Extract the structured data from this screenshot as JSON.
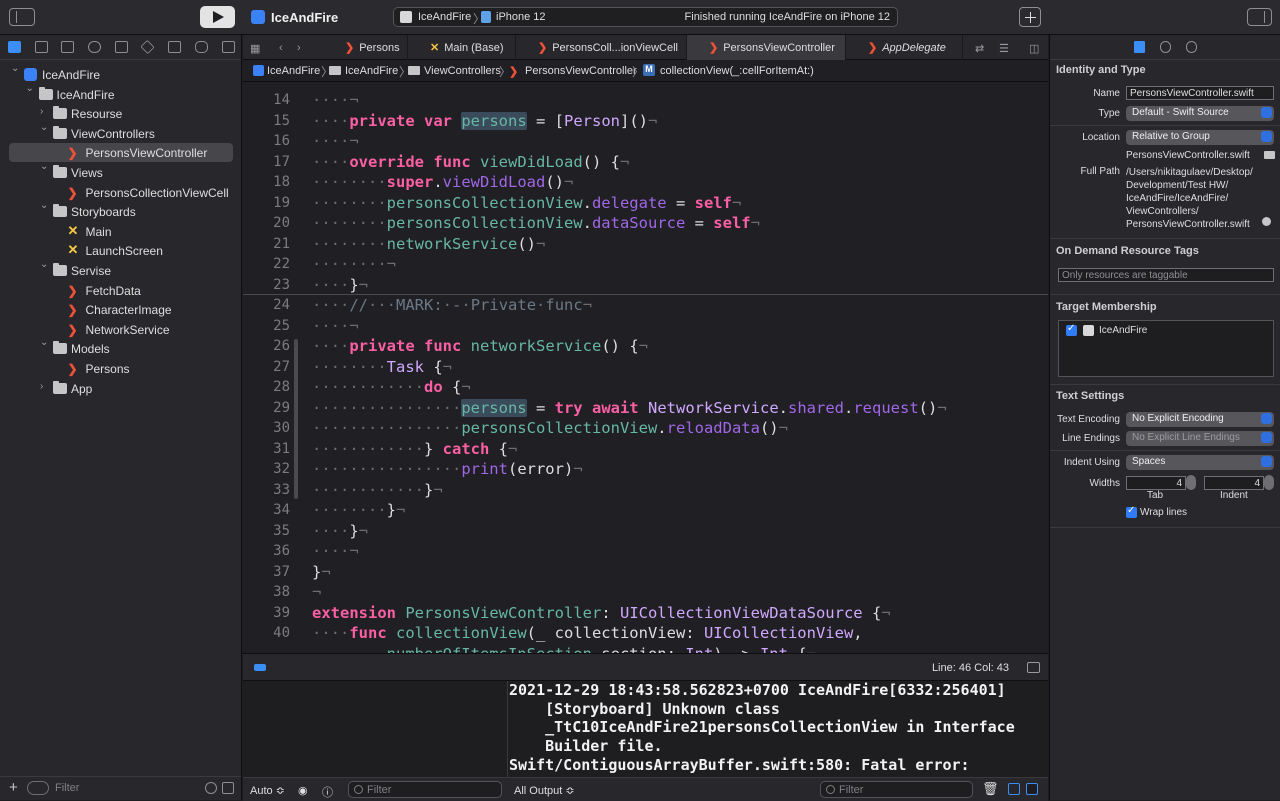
{
  "toolbar": {
    "scheme_title": "IceAndFire",
    "activity_scheme": "IceAndFire",
    "activity_destination": "iPhone 12",
    "activity_status": "Finished running IceAndFire on iPhone 12",
    "separator": "〉"
  },
  "navigator": {
    "items": [
      {
        "label": "IceAndFire",
        "depth": 0,
        "kind": "project",
        "disclosure": "open"
      },
      {
        "label": "IceAndFire",
        "depth": 1,
        "kind": "folder",
        "disclosure": "open"
      },
      {
        "label": "Resourse",
        "depth": 2,
        "kind": "folder",
        "disclosure": "closed"
      },
      {
        "label": "ViewControllers",
        "depth": 2,
        "kind": "folder",
        "disclosure": "open"
      },
      {
        "label": "PersonsViewController",
        "depth": 3,
        "kind": "swift",
        "selected": true
      },
      {
        "label": "Views",
        "depth": 2,
        "kind": "folder",
        "disclosure": "open"
      },
      {
        "label": "PersonsCollectionViewCell",
        "depth": 3,
        "kind": "swift"
      },
      {
        "label": "Storyboards",
        "depth": 2,
        "kind": "folder",
        "disclosure": "open"
      },
      {
        "label": "Main",
        "depth": 3,
        "kind": "storyboard"
      },
      {
        "label": "LaunchScreen",
        "depth": 3,
        "kind": "storyboard"
      },
      {
        "label": "Servise",
        "depth": 2,
        "kind": "folder",
        "disclosure": "open"
      },
      {
        "label": "FetchData",
        "depth": 3,
        "kind": "swift"
      },
      {
        "label": "CharacterImage",
        "depth": 3,
        "kind": "swift"
      },
      {
        "label": "NetworkService",
        "depth": 3,
        "kind": "swift"
      },
      {
        "label": "Models",
        "depth": 2,
        "kind": "folder",
        "disclosure": "open"
      },
      {
        "label": "Persons",
        "depth": 3,
        "kind": "swift"
      },
      {
        "label": "App",
        "depth": 2,
        "kind": "folder",
        "disclosure": "closed"
      }
    ],
    "filter_placeholder": "Filter",
    "add_label": "+"
  },
  "editor": {
    "tabs": [
      {
        "label": "Persons",
        "icon": "swift"
      },
      {
        "label": "Main (Base)",
        "icon": "storyboard"
      },
      {
        "label": "PersonsColl...ionViewCell",
        "icon": "swift"
      },
      {
        "label": "PersonsViewController",
        "icon": "swift",
        "active": true
      },
      {
        "label": "AppDelegate",
        "icon": "swift",
        "italic": true
      }
    ],
    "jump_bar": [
      "IceAndFire",
      "IceAndFire",
      "ViewControllers",
      "PersonsViewController",
      "collectionView(_:cellForItemAt:)"
    ],
    "jump_method_badge": "M",
    "code_lines": [
      {
        "n": "14",
        "segs": [
          [
            "inv",
            "····¬"
          ]
        ]
      },
      {
        "n": "15",
        "segs": [
          [
            "inv",
            "····"
          ],
          [
            "kw",
            "private"
          ],
          [
            "",
            " "
          ],
          [
            "kw",
            "var"
          ],
          [
            "",
            " "
          ],
          [
            "idhl",
            "persons"
          ],
          [
            "",
            " = ["
          ],
          [
            "ty",
            "Person"
          ],
          [
            "",
            "]()"
          ],
          [
            "inv",
            "¬"
          ]
        ]
      },
      {
        "n": "16",
        "segs": [
          [
            "inv",
            "····¬"
          ]
        ]
      },
      {
        "n": "17",
        "segs": [
          [
            "inv",
            "····"
          ],
          [
            "kw",
            "override"
          ],
          [
            "",
            " "
          ],
          [
            "kw",
            "func"
          ],
          [
            "",
            " "
          ],
          [
            "id",
            "viewDidLoad"
          ],
          [
            "",
            "() {"
          ],
          [
            "inv",
            "¬"
          ]
        ]
      },
      {
        "n": "18",
        "segs": [
          [
            "inv",
            "········"
          ],
          [
            "kw",
            "super"
          ],
          [
            "",
            "."
          ],
          [
            "fn",
            "viewDidLoad"
          ],
          [
            "",
            "()"
          ],
          [
            "inv",
            "¬"
          ]
        ]
      },
      {
        "n": "19",
        "segs": [
          [
            "inv",
            "········"
          ],
          [
            "id",
            "personsCollectionView"
          ],
          [
            "",
            "."
          ],
          [
            "fn",
            "delegate"
          ],
          [
            "",
            " = "
          ],
          [
            "kw",
            "self"
          ],
          [
            "inv",
            "¬"
          ]
        ]
      },
      {
        "n": "20",
        "segs": [
          [
            "inv",
            "········"
          ],
          [
            "id",
            "personsCollectionView"
          ],
          [
            "",
            "."
          ],
          [
            "fn",
            "dataSource"
          ],
          [
            "",
            " = "
          ],
          [
            "kw",
            "self"
          ],
          [
            "inv",
            "¬"
          ]
        ]
      },
      {
        "n": "21",
        "segs": [
          [
            "inv",
            "········"
          ],
          [
            "id",
            "networkService"
          ],
          [
            "",
            "()"
          ],
          [
            "inv",
            "¬"
          ]
        ]
      },
      {
        "n": "22",
        "segs": [
          [
            "inv",
            "········¬"
          ]
        ]
      },
      {
        "n": "23",
        "segs": [
          [
            "inv",
            "····"
          ],
          [
            "",
            "}"
          ],
          [
            "inv",
            "¬"
          ]
        ]
      },
      {
        "n": "24",
        "segs": [
          [
            "inv",
            "····"
          ],
          [
            "cm",
            "//"
          ],
          [
            "inv",
            "···"
          ],
          [
            "cm",
            "MARK:"
          ],
          [
            "inv",
            "·"
          ],
          [
            "cm",
            "-"
          ],
          [
            "inv",
            "·"
          ],
          [
            "cm",
            "Private"
          ],
          [
            "inv",
            "·"
          ],
          [
            "cm",
            "func"
          ],
          [
            "inv",
            "¬"
          ]
        ]
      },
      {
        "n": "25",
        "segs": [
          [
            "inv",
            "····¬"
          ]
        ]
      },
      {
        "n": "26",
        "segs": [
          [
            "inv",
            "····"
          ],
          [
            "kw",
            "private"
          ],
          [
            "",
            " "
          ],
          [
            "kw",
            "func"
          ],
          [
            "",
            " "
          ],
          [
            "id",
            "networkService"
          ],
          [
            "",
            "() {"
          ],
          [
            "inv",
            "¬"
          ]
        ]
      },
      {
        "n": "27",
        "segs": [
          [
            "inv",
            "········"
          ],
          [
            "ty",
            "Task"
          ],
          [
            "",
            " {"
          ],
          [
            "inv",
            "¬"
          ]
        ]
      },
      {
        "n": "28",
        "segs": [
          [
            "inv",
            "············"
          ],
          [
            "kw",
            "do"
          ],
          [
            "",
            " {"
          ],
          [
            "inv",
            "¬"
          ]
        ]
      },
      {
        "n": "29",
        "segs": [
          [
            "inv",
            "················"
          ],
          [
            "idhl",
            "persons"
          ],
          [
            "",
            " = "
          ],
          [
            "kw",
            "try"
          ],
          [
            "",
            " "
          ],
          [
            "kw",
            "await"
          ],
          [
            "",
            " "
          ],
          [
            "ty",
            "NetworkService"
          ],
          [
            "",
            "."
          ],
          [
            "fn",
            "shared"
          ],
          [
            "",
            "."
          ],
          [
            "fn",
            "request"
          ],
          [
            "",
            "()"
          ],
          [
            "inv",
            "¬"
          ]
        ]
      },
      {
        "n": "30",
        "segs": [
          [
            "inv",
            "················"
          ],
          [
            "id",
            "personsCollectionView"
          ],
          [
            "",
            "."
          ],
          [
            "fn",
            "reloadData"
          ],
          [
            "",
            "()"
          ],
          [
            "inv",
            "¬"
          ]
        ]
      },
      {
        "n": "31",
        "segs": [
          [
            "inv",
            "············"
          ],
          [
            "",
            "} "
          ],
          [
            "kw",
            "catch"
          ],
          [
            "",
            " {"
          ],
          [
            "inv",
            "¬"
          ]
        ]
      },
      {
        "n": "32",
        "segs": [
          [
            "inv",
            "················"
          ],
          [
            "fn",
            "print"
          ],
          [
            "",
            "(error)"
          ],
          [
            "inv",
            "¬"
          ]
        ]
      },
      {
        "n": "33",
        "segs": [
          [
            "inv",
            "············"
          ],
          [
            "",
            "}"
          ],
          [
            "inv",
            "¬"
          ]
        ]
      },
      {
        "n": "34",
        "segs": [
          [
            "inv",
            "········"
          ],
          [
            "",
            "}"
          ],
          [
            "inv",
            "¬"
          ]
        ]
      },
      {
        "n": "35",
        "segs": [
          [
            "inv",
            "····"
          ],
          [
            "",
            "}"
          ],
          [
            "inv",
            "¬"
          ]
        ]
      },
      {
        "n": "36",
        "segs": [
          [
            "inv",
            "····¬"
          ]
        ]
      },
      {
        "n": "37",
        "segs": [
          [
            "",
            "}"
          ],
          [
            "inv",
            "¬"
          ]
        ]
      },
      {
        "n": "38",
        "segs": [
          [
            "inv",
            "¬"
          ]
        ]
      },
      {
        "n": "39",
        "segs": [
          [
            "kw",
            "extension"
          ],
          [
            "",
            " "
          ],
          [
            "id",
            "PersonsViewController"
          ],
          [
            "",
            ": "
          ],
          [
            "ty",
            "UICollectionViewDataSource"
          ],
          [
            "",
            " {"
          ],
          [
            "inv",
            "¬"
          ]
        ]
      },
      {
        "n": "40",
        "segs": [
          [
            "inv",
            "····"
          ],
          [
            "kw",
            "func"
          ],
          [
            "",
            " "
          ],
          [
            "id",
            "collectionView"
          ],
          [
            "",
            "(_ collectionView: "
          ],
          [
            "ty",
            "UICollectionView"
          ],
          [
            "",
            ","
          ]
        ]
      },
      {
        "n": "",
        "segs": [
          [
            "inv",
            "        "
          ],
          [
            "id",
            "numberOfItemsInSection"
          ],
          [
            "",
            " section: "
          ],
          [
            "ty",
            "Int"
          ],
          [
            "",
            ") -> "
          ],
          [
            "ty",
            "Int"
          ],
          [
            "",
            " {"
          ],
          [
            "inv",
            "¬"
          ]
        ]
      }
    ],
    "cursor_position": "Line: 46  Col: 43"
  },
  "debug": {
    "console_lines": [
      "2021-12-29 18:43:58.562823+0700 IceAndFire[6332:256401]",
      "    [Storyboard] Unknown class",
      "    _TtC10IceAndFire21personsCollectionView in Interface",
      "    Builder file.",
      "Swift/ContiguousArrayBuffer.swift:580: Fatal error:"
    ],
    "auto_label": "Auto ≎",
    "filter_placeholder": "Filter",
    "output_label": "All Output ≎"
  },
  "inspector": {
    "identity_header": "Identity and Type",
    "name_label": "Name",
    "name_value": "PersonsViewController.swift",
    "type_label": "Type",
    "type_value": "Default - Swift Source",
    "location_label": "Location",
    "location_value": "Relative to Group",
    "location_file": "PersonsViewController.swift",
    "full_path_label": "Full Path",
    "full_path_lines": [
      "/Users/nikitagulaev/Desktop/",
      "Development/Test HW/",
      "IceAndFire/IceAndFire/",
      "ViewControllers/",
      "PersonsViewController.swift"
    ],
    "odr_header": "On Demand Resource Tags",
    "odr_placeholder": "Only resources are taggable",
    "target_header": "Target Membership",
    "target_name": "IceAndFire",
    "text_header": "Text Settings",
    "encoding_label": "Text Encoding",
    "encoding_value": "No Explicit Encoding",
    "line_endings_label": "Line Endings",
    "line_endings_value": "No Explicit Line Endings",
    "indent_using_label": "Indent Using",
    "indent_using_value": "Spaces",
    "widths_label": "Widths",
    "tab_value": "4",
    "tab_caption": "Tab",
    "indent_value": "4",
    "indent_caption": "Indent",
    "wrap_label": "Wrap lines"
  }
}
